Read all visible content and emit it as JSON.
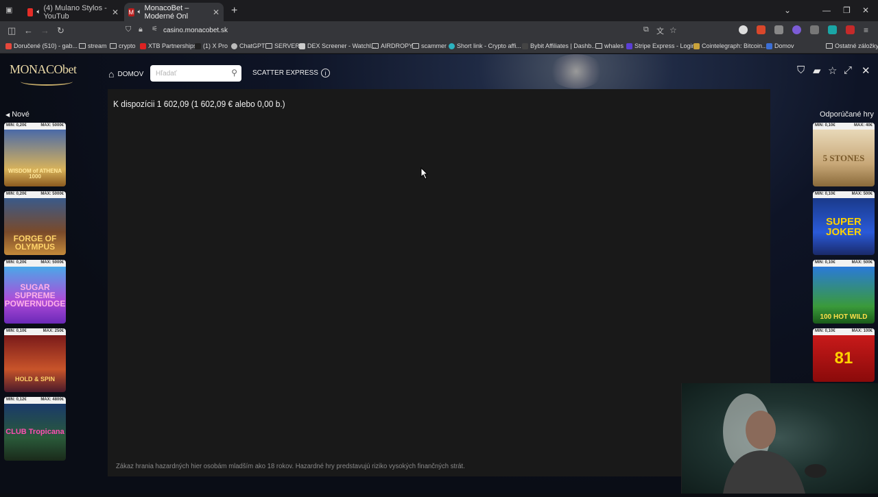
{
  "tabs": [
    {
      "label": "(4) Mulano Stylos - YouTub",
      "active": false
    },
    {
      "label": "MonacoBet – Moderné Onl",
      "active": true
    }
  ],
  "toolbar": {
    "url": "casino.monacobet.sk"
  },
  "bookmarks": [
    "Doručené (510) - gab...",
    "stream",
    "crypto",
    "XTB Partnerships",
    "(1) X Pro",
    "ChatGPT",
    "SERVER",
    "DEX Screener - Watchl...",
    "AIRDROPY",
    "scammer",
    "Short link - Crypto affi...",
    "Bybit Affiliates | Dashb...",
    "whales",
    "Stripe Express - Login",
    "Cointelegraph: Bitcoin...",
    "Domov",
    "Ostatné záložky"
  ],
  "site": {
    "logo": "MONACObet",
    "nav_home": "DOMOV",
    "search_placeholder": "Hľadať",
    "scatter": "SCATTER EXPRESS",
    "balance": "K dispozícii 1 602,09 (1 602,09 € alebo 0,00 b.)",
    "disclaimer": "Zákaz hrania hazardných hier osobám mladším ako 18 rokov. Hazardné hry predstavujú riziko vysokých finančných strát.",
    "left_title": "Nové",
    "right_title": "Odporúčané hry",
    "left_games": [
      {
        "min": "MIN: 0,20€",
        "max": "MAX: 5000€",
        "name": "WISDOM of ATHENA 1000"
      },
      {
        "min": "MIN: 0,20€",
        "max": "MAX: 5000€",
        "name": "FORGE OF OLYMPUS"
      },
      {
        "min": "MIN: 0,20€",
        "max": "MAX: 5000€",
        "name": "SUGAR SUPREME POWERNUDGE"
      },
      {
        "min": "MIN: 0,10€",
        "max": "MAX: 250€",
        "name": "HOLD & SPIN"
      },
      {
        "min": "MIN: 0,12€",
        "max": "MAX: 4800€",
        "name": "CLUB Tropicana"
      }
    ],
    "right_games": [
      {
        "min": "MIN: 0,10€",
        "max": "MAX: 40€",
        "name": "5 STONES"
      },
      {
        "min": "MIN: 0,10€",
        "max": "MAX: 500€",
        "name": "SUPER JOKER"
      },
      {
        "min": "MIN: 0,10€",
        "max": "MAX: 500€",
        "name": "100 HOT WILD"
      },
      {
        "min": "MIN: 0,10€",
        "max": "MAX: 100€",
        "name": "81"
      }
    ]
  },
  "colors": {
    "gold": "#e9d8a6",
    "panel": "#191919",
    "chrome": "#35363a"
  }
}
